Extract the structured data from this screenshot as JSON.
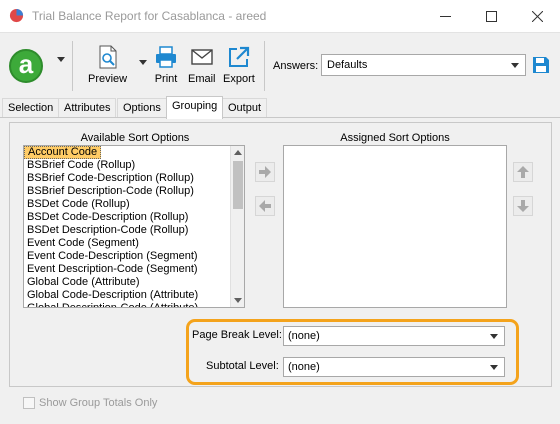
{
  "window": {
    "title": "Trial Balance Report for Casablanca - areed"
  },
  "toolbar": {
    "logo_letter": "a",
    "preview_label": "Preview",
    "print_label": "Print",
    "email_label": "Email",
    "export_label": "Export",
    "answers_label": "Answers:",
    "answers_value": "Defaults"
  },
  "tabs": [
    {
      "label": "Selection"
    },
    {
      "label": "Attributes"
    },
    {
      "label": "Options"
    },
    {
      "label": "Grouping",
      "active": true
    },
    {
      "label": "Output"
    }
  ],
  "grouping": {
    "available_header": "Available Sort Options",
    "assigned_header": "Assigned Sort Options",
    "available_options": [
      "Account Code",
      "BSBrief Code (Rollup)",
      "BSBrief Code-Description (Rollup)",
      "BSBrief Description-Code (Rollup)",
      "BSDet Code (Rollup)",
      "BSDet Code-Description (Rollup)",
      "BSDet Description-Code (Rollup)",
      "Event Code (Segment)",
      "Event Code-Description (Segment)",
      "Event Description-Code (Segment)",
      "Global Code (Attribute)",
      "Global Code-Description (Attribute)",
      "Global Description-Code (Attribute)"
    ],
    "selected_option": "Account Code",
    "assigned_options": [],
    "page_break_label": "Page Break Level:",
    "page_break_value": "(none)",
    "subtotal_label": "Subtotal Level:",
    "subtotal_value": "(none)",
    "show_group_totals_label": "Show Group Totals Only",
    "show_group_totals_checked": false
  },
  "colors": {
    "highlight": "#f4a31c",
    "logo_green": "#3daa3a",
    "selection": "#ffcc66",
    "accent_blue": "#1e88d0"
  },
  "icons": [
    "pie-chart-icon",
    "minimize-icon",
    "maximize-icon",
    "close-icon",
    "preview-icon",
    "printer-icon",
    "email-icon",
    "export-icon",
    "save-icon",
    "arrow-right-icon",
    "arrow-left-icon",
    "arrow-up-icon",
    "arrow-down-icon"
  ]
}
